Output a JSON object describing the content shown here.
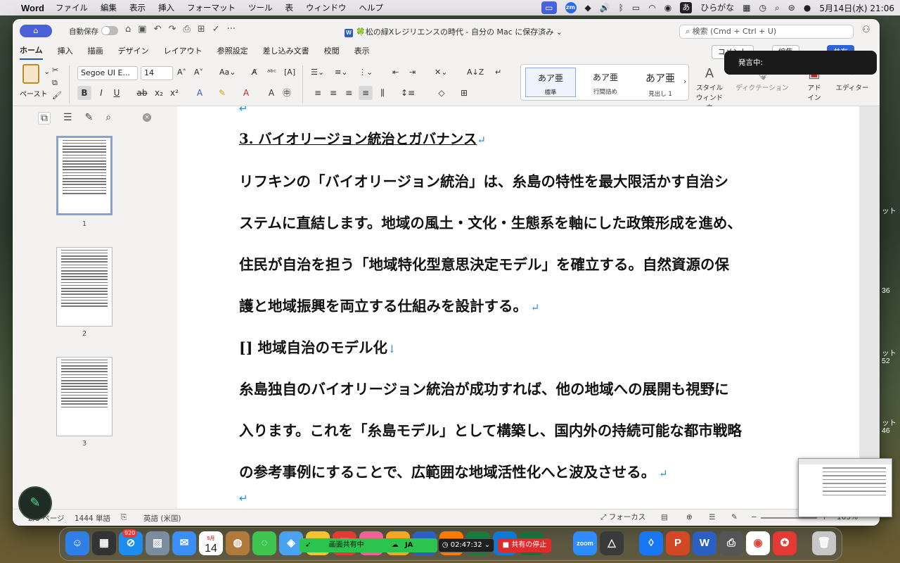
{
  "menubar": {
    "apple": "",
    "app_name": "Word",
    "items": [
      "ファイル",
      "編集",
      "表示",
      "挿入",
      "フォーマット",
      "ツール",
      "表",
      "ウィンドウ",
      "ヘルプ"
    ],
    "ime_label": "ひらがな",
    "ime_char": "あ",
    "zoom_label": "zm",
    "datetime": "5月14日(水)  21:06"
  },
  "titlebar": {
    "autosave_label": "自動保存",
    "doc_title": "🍀松の緑Xレジリエンスの時代 - 自分の Mac に保存済み",
    "doc_icon_label": "W",
    "search_placeholder": "検索 (Cmd + Ctrl + U)"
  },
  "ribbon": {
    "tabs": [
      "ホーム",
      "挿入",
      "描画",
      "デザイン",
      "レイアウト",
      "参照設定",
      "差し込み文書",
      "校閲",
      "表示"
    ],
    "active_tab": "ホーム",
    "paste_label": "ペースト",
    "font_name": "Segoe UI E...",
    "font_size": "14",
    "styles": [
      {
        "preview": "あア亜",
        "label": "標準"
      },
      {
        "preview": "あア亜",
        "label": "行間詰め"
      },
      {
        "preview": "あア亜",
        "label": "見出し 1"
      }
    ],
    "style_window_label": "スタイル\nウィンドウ",
    "dictation_label": "ディクテーション",
    "addin_label": "アド\nイン",
    "editor_label": "エディター",
    "comment_btn": "コメント",
    "edit_btn": "編集",
    "share_btn": "共有"
  },
  "dictation_popup": "発言中:",
  "nav": {
    "thumbnails": [
      "1",
      "2",
      "3"
    ]
  },
  "document": {
    "heading": "3. バイオリージョン統治とガバナンス",
    "para1": [
      "リフキンの「バイオリージョン統治」は、糸島の特性を最大限活かす自治シ",
      "ステムに直結します。地域の風土・文化・生態系を軸にした政策形成を進め、",
      "住民が自治を担う「地域特化型意思決定モデル」を確立する。自然資源の保",
      "護と地域振興を両立する仕組みを設計する。"
    ],
    "subheading": "[] 地域自治のモデル化",
    "para2": [
      "糸島独自のバイオリージョン統治が成功すれば、他の地域への展開も視野に",
      "入ります。これを「糸島モデル」として構築し、国内外の持続可能な都市戦略",
      "の参考事例にすることで、広範囲な地域活性化へと波及させる。"
    ]
  },
  "statusbar": {
    "page": "2/3 ページ",
    "words": "1444 単語",
    "language": "英語 (米国)",
    "focus": "フォーカス",
    "zoom": "165%"
  },
  "desktop_text": [
    "ット",
    "36",
    "ット",
    "52",
    "ット",
    "46"
  ],
  "dock": {
    "mail_badge": "920",
    "calendar_month": "5月",
    "calendar_day": "14",
    "share_status": "画面共有中",
    "share_lang": "JA",
    "timer": "02:47:32",
    "stop_share": "共有の停止",
    "zoom_label": "zoom"
  }
}
